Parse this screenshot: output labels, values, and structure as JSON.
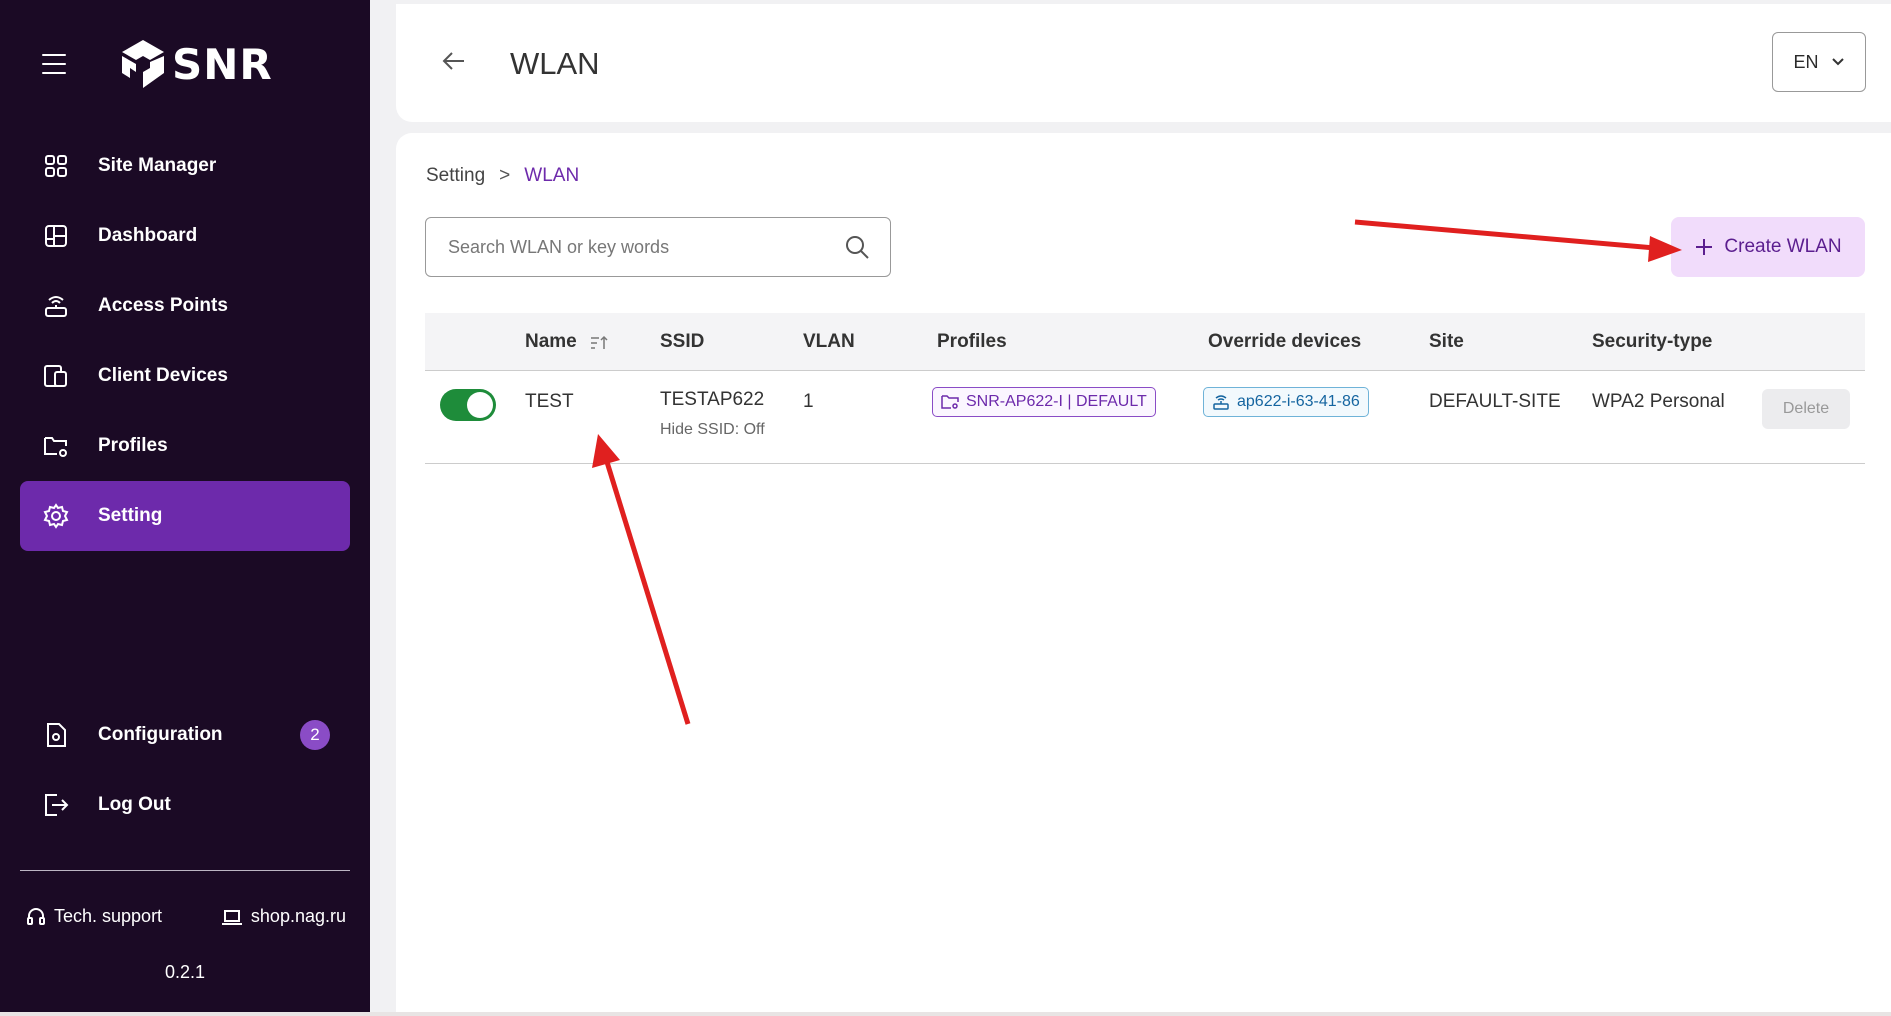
{
  "app": {
    "logo_text": "SNR",
    "version": "0.2.1"
  },
  "sidebar": {
    "items": [
      {
        "label": "Site Manager",
        "icon": "grid-icon"
      },
      {
        "label": "Dashboard",
        "icon": "dashboard-icon"
      },
      {
        "label": "Access Points",
        "icon": "access-point-icon"
      },
      {
        "label": "Client Devices",
        "icon": "devices-icon"
      },
      {
        "label": "Profiles",
        "icon": "folder-gear-icon"
      },
      {
        "label": "Setting",
        "icon": "gear-icon",
        "active": true
      }
    ],
    "bottom_items": [
      {
        "label": "Configuration",
        "icon": "document-gear-icon",
        "badge": "2"
      },
      {
        "label": "Log Out",
        "icon": "logout-icon"
      }
    ],
    "footer": {
      "support": "Tech. support",
      "shop": "shop.nag.ru"
    }
  },
  "header": {
    "title": "WLAN",
    "language": "EN"
  },
  "breadcrumb": {
    "parent": "Setting",
    "separator": ">",
    "current": "WLAN"
  },
  "search": {
    "placeholder": "Search WLAN or key words",
    "value": ""
  },
  "create_button": {
    "label": "Create WLAN"
  },
  "table": {
    "columns": [
      "Name",
      "SSID",
      "VLAN",
      "Profiles",
      "Override devices",
      "Site",
      "Security-type"
    ],
    "rows": [
      {
        "enabled": true,
        "name": "TEST",
        "ssid": "TESTAP622",
        "ssid_sub": "Hide SSID: Off",
        "vlan": "1",
        "profile": "SNR-AP622-I | DEFAULT",
        "device": "ap622-i-63-41-86",
        "site": "DEFAULT-SITE",
        "security": "WPA2 Personal",
        "action": "Delete"
      }
    ]
  },
  "colors": {
    "sidebar_bg": "#1b0a25",
    "accent": "#6d2aab",
    "toggle_on": "#1e8c3a",
    "annotation_arrow": "#e0201f"
  }
}
